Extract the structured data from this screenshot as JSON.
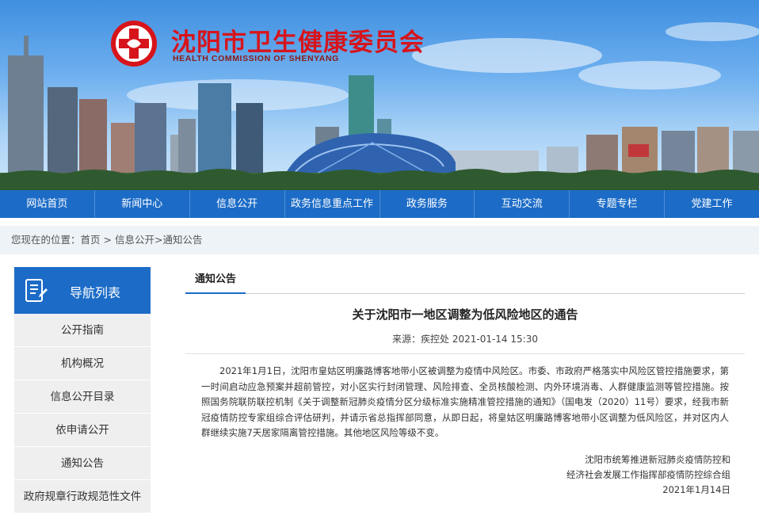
{
  "header": {
    "title": "沈阳市卫生健康委员会",
    "subtitle": "HEALTH COMMISSION OF SHENYANG",
    "colors": {
      "title": "#d7141b",
      "nav": "#1c6cc7"
    },
    "emblem": "red-cross-emblem-icon"
  },
  "nav": {
    "items": [
      {
        "label": "网站首页"
      },
      {
        "label": "新闻中心"
      },
      {
        "label": "信息公开"
      },
      {
        "label": "政务信息重点工作"
      },
      {
        "label": "政务服务"
      },
      {
        "label": "互动交流"
      },
      {
        "label": "专题专栏"
      },
      {
        "label": "党建工作"
      }
    ]
  },
  "breadcrumb": {
    "prefix": "您现在的位置：",
    "home": "首页",
    "sep1": " > ",
    "section": "信息公开",
    "sep2": ">",
    "current": "通知公告"
  },
  "sidebar": {
    "title": "导航列表",
    "icon": "document-list-icon",
    "items": [
      {
        "label": "公开指南"
      },
      {
        "label": "机构概况"
      },
      {
        "label": "信息公开目录"
      },
      {
        "label": "依申请公开"
      },
      {
        "label": "通知公告"
      },
      {
        "label": "政府规章行政规范性文件"
      }
    ]
  },
  "main": {
    "tab": "通知公告",
    "article": {
      "title": "关于沈阳市一地区调整为低风险地区的通告",
      "meta": "来源：疾控处  2021-01-14 15:30",
      "body": "2021年1月1日，沈阳市皇姑区明廉路博客地带小区被调整为疫情中风险区。市委、市政府严格落实中风险区管控措施要求，第一时间启动应急预案并超前管控，对小区实行封闭管理、风险排查、全员核酸检测、内外环境消毒、人群健康监测等管控措施。按照国务院联防联控机制《关于调整新冠肺炎疫情分区分级标准实施精准管控措施的通知》（国电发（2020）11号）要求，经我市新冠疫情防控专家组综合评估研判，并请示省总指挥部同意，从即日起，将皇姑区明廉路博客地带小区调整为低风险区，并对区内人群继续实施7天居家隔离管控措施。其他地区风险等级不变。",
      "sign_line1": "沈阳市统筹推进新冠肺炎疫情防控和",
      "sign_line2": "经济社会发展工作指挥部疫情防控综合组",
      "sign_date": "2021年1月14日"
    }
  }
}
